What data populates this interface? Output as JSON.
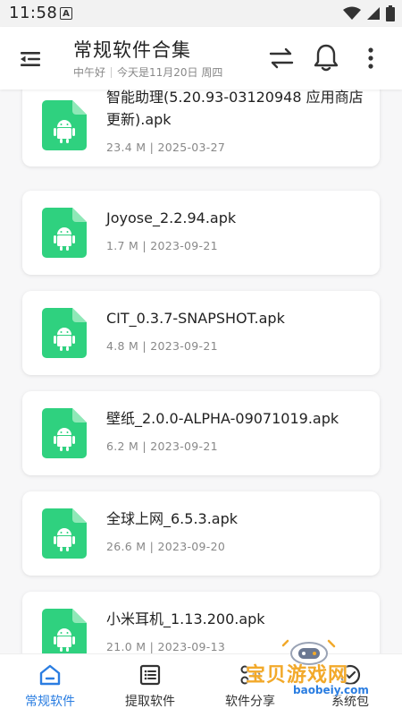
{
  "status_bar": {
    "time": "11:58",
    "notif_letter": "A"
  },
  "app_bar": {
    "title": "常规软件合集",
    "greeting": "中午好",
    "date_text": "今天是11月20日 周四"
  },
  "files": [
    {
      "name": "智能助理(5.20.93-03120948 应用商店更新).apk",
      "meta": "23.4 M | 2025-03-27"
    },
    {
      "name": "Joyose_2.2.94.apk",
      "meta": "1.7 M | 2023-09-21"
    },
    {
      "name": "CIT_0.3.7-SNAPSHOT.apk",
      "meta": "4.8 M | 2023-09-21"
    },
    {
      "name": "壁纸_2.0.0-ALPHA-09071019.apk",
      "meta": "6.2 M | 2023-09-21"
    },
    {
      "name": "全球上网_6.5.3.apk",
      "meta": "26.6 M | 2023-09-20"
    },
    {
      "name": "小米耳机_1.13.200.apk",
      "meta": "21.0 M | 2023-09-13"
    }
  ],
  "bottom_nav": [
    {
      "label": "常规软件",
      "icon": "home-icon",
      "active": true
    },
    {
      "label": "提取软件",
      "icon": "list-icon",
      "active": false
    },
    {
      "label": "软件分享",
      "icon": "share-icon",
      "active": false
    },
    {
      "label": "系统包",
      "icon": "package-icon",
      "active": false
    }
  ],
  "watermark": {
    "text": "宝贝游戏网",
    "url": "baobeiy.com"
  },
  "colors": {
    "accent": "#2a7de1",
    "apk_green": "#2fd17f",
    "watermark": "#f2a92a"
  }
}
